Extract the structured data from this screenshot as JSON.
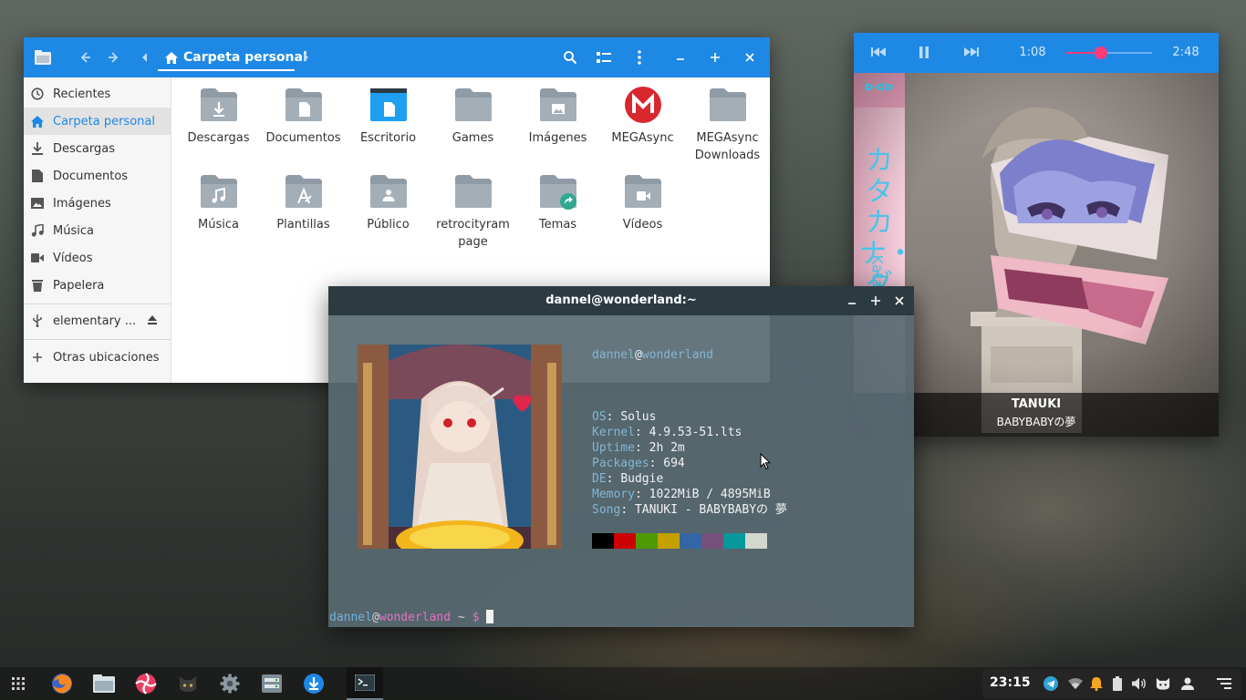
{
  "file_manager": {
    "location": "Carpeta personal",
    "sidebar": [
      {
        "label": "Recientes",
        "icon": "clock-icon"
      },
      {
        "label": "Carpeta personal",
        "icon": "home-icon",
        "active": true
      },
      {
        "label": "Descargas",
        "icon": "download-icon"
      },
      {
        "label": "Documentos",
        "icon": "document-icon"
      },
      {
        "label": "Imágenes",
        "icon": "image-icon"
      },
      {
        "label": "Música",
        "icon": "music-icon"
      },
      {
        "label": "Vídeos",
        "icon": "video-icon"
      },
      {
        "label": "Papelera",
        "icon": "trash-icon"
      }
    ],
    "device": {
      "label": "elementary ...",
      "icon": "usb-icon"
    },
    "other_locations": "Otras ubicaciones",
    "items": [
      {
        "line1": "Descargas",
        "line2": "",
        "icon": "folder-download-icon"
      },
      {
        "line1": "Documentos",
        "line2": "",
        "icon": "folder-documents-icon"
      },
      {
        "line1": "Escritorio",
        "line2": "",
        "icon": "folder-desktop-icon"
      },
      {
        "line1": "Games",
        "line2": "",
        "icon": "folder-icon"
      },
      {
        "line1": "Imágenes",
        "line2": "",
        "icon": "folder-pictures-icon"
      },
      {
        "line1": "MEGAsync",
        "line2": "",
        "icon": "mega-icon"
      },
      {
        "line1": "MEGAsync",
        "line2": "Downloads",
        "icon": "folder-icon"
      },
      {
        "line1": "Música",
        "line2": "",
        "icon": "folder-music-icon"
      },
      {
        "line1": "Plantillas",
        "line2": "",
        "icon": "folder-templates-icon"
      },
      {
        "line1": "Público",
        "line2": "",
        "icon": "folder-public-icon"
      },
      {
        "line1": "retrocityram",
        "line2": "page",
        "icon": "folder-icon"
      },
      {
        "line1": "Temas",
        "line2": "",
        "icon": "folder-shared-icon"
      },
      {
        "line1": "Vídeos",
        "line2": "",
        "icon": "folder-videos-icon"
      }
    ],
    "colors": {
      "accent": "#1e88e5",
      "folder": "#8f9ba5"
    }
  },
  "music_player": {
    "elapsed": "1:08",
    "duration": "2:48",
    "progress": 0.4,
    "title": "TANUKI",
    "artist": "BABYBABYの夢",
    "album_art_side_text": "カタカナ・ダ",
    "album_art_sub_text": "Katakana"
  },
  "terminal": {
    "title": "dannel@wonderland:~",
    "user": "dannel",
    "at": "@",
    "host": "wonderland",
    "info": [
      {
        "key": "OS",
        "value": "Solus"
      },
      {
        "key": "Kernel",
        "value": "4.9.53-51.lts"
      },
      {
        "key": "Uptime",
        "value": "2h 2m"
      },
      {
        "key": "Packages",
        "value": "694"
      },
      {
        "key": "DE",
        "value": "Budgie"
      },
      {
        "key": "Memory",
        "value": "1022MiB / 4895MiB"
      },
      {
        "key": "Song",
        "value": "TANUKI - BABYBABYの 夢"
      }
    ],
    "palette": [
      "#000000",
      "#cc0000",
      "#4e9a06",
      "#c4a000",
      "#3465a4",
      "#75507b",
      "#06989a",
      "#d3d7cf"
    ],
    "prompt": {
      "user": "dannel",
      "at": "@",
      "host": "wonderland",
      "path": "~",
      "symbol": "$"
    }
  },
  "taskbar": {
    "apps": [
      "app-menu-icon",
      "firefox-icon",
      "files-icon",
      "lollypop-icon",
      "cat-app-icon",
      "settings-icon",
      "software-center-icon",
      "downloader-icon",
      "terminal-icon"
    ],
    "clock": "23:15",
    "tray": [
      "telegram-icon",
      "wifi-icon",
      "notification-bell-icon",
      "battery-icon",
      "volume-icon",
      "cat-tray-icon",
      "user-icon",
      "raven-toggle-icon"
    ]
  }
}
